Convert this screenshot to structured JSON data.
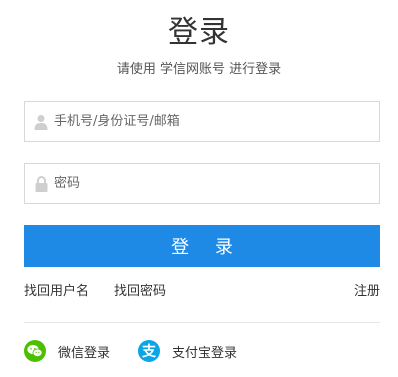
{
  "header": {
    "title": "登录",
    "subtitle": "请使用 学信网账号 进行登录"
  },
  "form": {
    "username_placeholder": "手机号/身份证号/邮箱",
    "username_value": "",
    "password_placeholder": "密码",
    "password_value": "",
    "submit_label": "登 录"
  },
  "links": {
    "recover_username": "找回用户名",
    "recover_password": "找回密码",
    "register": "注册"
  },
  "social": {
    "wechat_label": "微信登录",
    "alipay_label": "支付宝登录",
    "alipay_glyph": "支"
  },
  "colors": {
    "primary_button": "#1e8ae6",
    "wechat_green": "#4cbf00",
    "alipay_blue": "#0aa5e8"
  }
}
